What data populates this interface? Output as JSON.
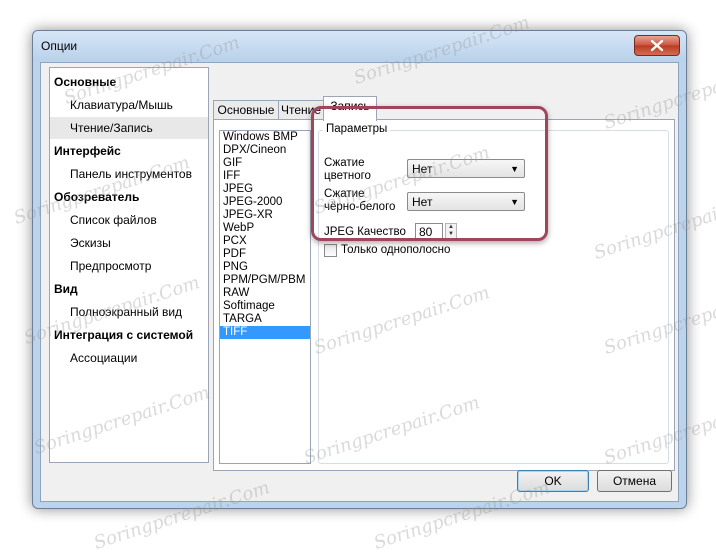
{
  "window": {
    "title": "Опции",
    "close_icon": "close-icon"
  },
  "nav": {
    "items": [
      {
        "label": "Основные",
        "level": "category"
      },
      {
        "label": "Клавиатура/Мышь",
        "level": "sub"
      },
      {
        "label": "Чтение/Запись",
        "level": "sub",
        "selected": true
      },
      {
        "label": "Интерфейс",
        "level": "category"
      },
      {
        "label": "Панель инструментов",
        "level": "sub"
      },
      {
        "label": "Обозреватель",
        "level": "category"
      },
      {
        "label": "Список файлов",
        "level": "sub"
      },
      {
        "label": "Эскизы",
        "level": "sub"
      },
      {
        "label": "Предпросмотр",
        "level": "sub"
      },
      {
        "label": "Вид",
        "level": "category"
      },
      {
        "label": "Полноэкранный вид",
        "level": "sub"
      },
      {
        "label": "Интеграция с системой",
        "level": "category"
      },
      {
        "label": "Ассоциации",
        "level": "sub"
      }
    ]
  },
  "tabs": [
    {
      "label": "Основные"
    },
    {
      "label": "Чтение"
    },
    {
      "label": "Запись",
      "active": true
    }
  ],
  "formats": [
    "Windows BMP",
    "DPX/Cineon",
    "GIF",
    "IFF",
    "JPEG",
    "JPEG-2000",
    "JPEG-XR",
    "WebP",
    "PCX",
    "PDF",
    "PNG",
    "PPM/PGM/PBM",
    "RAW",
    "Softimage",
    "TARGA",
    "TIFF"
  ],
  "selected_format": "TIFF",
  "params": {
    "legend": "Параметры",
    "color_compression": {
      "label_line1": "Сжатие",
      "label_line2": "цветного",
      "value": "Нет"
    },
    "bw_compression": {
      "label_line1": "Сжатие",
      "label_line2": "чёрно-белого",
      "value": "Нет"
    },
    "jpeg_quality": {
      "label": "JPEG Качество",
      "value": "80"
    },
    "single_strip": {
      "label": "Только однополосно",
      "checked": false
    }
  },
  "buttons": {
    "ok": "OK",
    "cancel": "Отмена"
  },
  "watermark": "Soringpcrepair.Com",
  "colors": {
    "highlight": "#a1455a",
    "selection": "#3399ff"
  }
}
